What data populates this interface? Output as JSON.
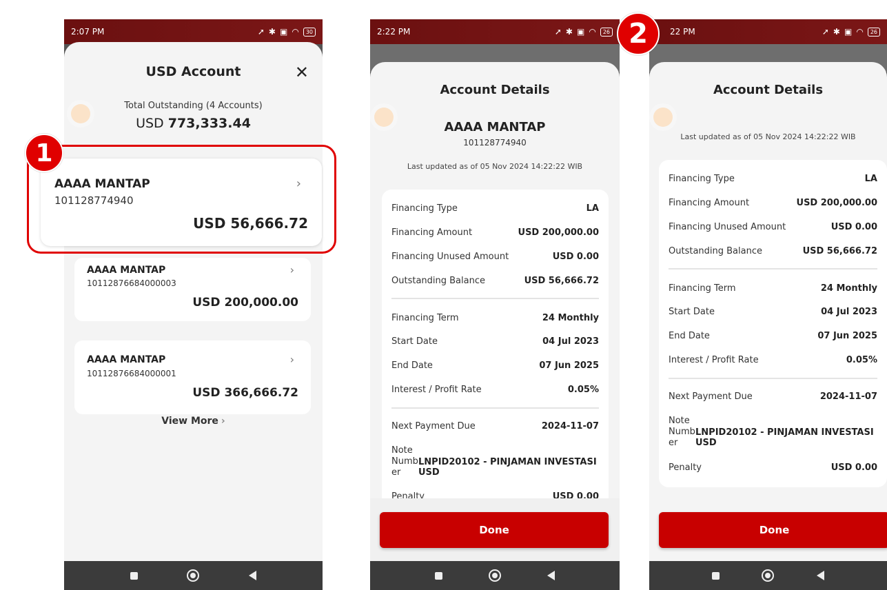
{
  "phone1": {
    "time": "2:07 PM",
    "battery": "30",
    "title": "USD Account",
    "outstanding_label": "Total Outstanding (4 Accounts)",
    "outstanding_currency": "USD",
    "outstanding_value": "773,333.44",
    "accounts": [
      {
        "name": "AAAA MANTAP",
        "number": "101128774940",
        "amount": "USD 56,666.72"
      },
      {
        "name": "AAAA MANTAP",
        "number": "10112876684000003",
        "amount": "USD 200,000.00"
      },
      {
        "name": "AAAA MANTAP",
        "number": "10112876684000001",
        "amount": "USD 366,666.72"
      }
    ],
    "view_more": "View More"
  },
  "badges": {
    "one": "1",
    "two": "2"
  },
  "phone2": {
    "time": "2:22 PM",
    "battery": "26",
    "title": "Account Details",
    "name": "AAAA MANTAP",
    "number": "101128774940",
    "updated": "Last updated as of 05 Nov 2024 14:22:22 WIB",
    "done": "Done"
  },
  "phone3": {
    "time": "22 PM",
    "battery": "26",
    "title": "Account Details",
    "updated": "Last updated as of 05 Nov 2024 14:22:22 WIB",
    "done": "Done"
  },
  "details": {
    "financing_type": {
      "label": "Financing Type",
      "value": "LA"
    },
    "financing_amount": {
      "label": "Financing Amount",
      "value": "USD 200,000.00"
    },
    "unused_amount": {
      "label": "Financing Unused Amount",
      "value": "USD 0.00"
    },
    "outstanding_balance": {
      "label": "Outstanding Balance",
      "value": "USD 56,666.72"
    },
    "financing_term": {
      "label": "Financing Term",
      "value": "24 Monthly"
    },
    "start_date": {
      "label": "Start Date",
      "value": "04 Jul 2023"
    },
    "end_date": {
      "label": "End Date",
      "value": "07 Jun 2025"
    },
    "rate": {
      "label": "Interest / Profit Rate",
      "value": "0.05%"
    },
    "next_payment": {
      "label": "Next Payment Due",
      "value": "2024-11-07"
    },
    "note": {
      "label_1": "Note",
      "label_2": "Numb",
      "label_3": "er",
      "value": "LNPID20102 - PINJAMAN INVESTASI USD"
    },
    "penalty": {
      "label": "Penalty",
      "value": "USD 0.00"
    }
  },
  "icons": [
    "location-icon",
    "bluetooth-icon",
    "nfc-icon",
    "wifi-icon",
    "battery-icon",
    "close-icon",
    "chevron-right-icon",
    "nav-square-icon",
    "nav-home-icon",
    "nav-back-icon"
  ],
  "colors": {
    "brand_red": "#c80000",
    "highlight_red": "#e00000",
    "status_bar": "#6b1010"
  }
}
